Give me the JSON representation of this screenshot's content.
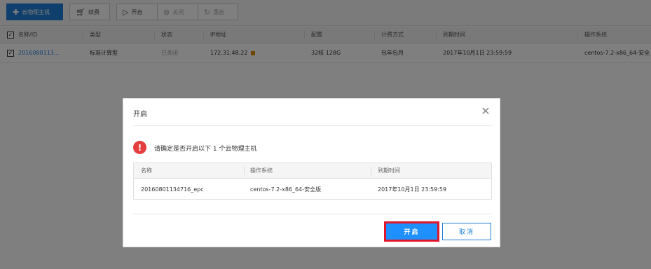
{
  "toolbar": {
    "create": {
      "label": "云物理主机",
      "icon": "plus-icon"
    },
    "renew": {
      "label": "续费",
      "icon": "cart-icon"
    },
    "start": {
      "label": "开启",
      "icon": "play-circle-icon"
    },
    "stop": {
      "label": "关闭",
      "icon": "stop-circle-icon"
    },
    "restart": {
      "label": "重启",
      "icon": "restart-icon"
    }
  },
  "table": {
    "headers": [
      "名称/ID",
      "类型",
      "状态",
      "IP地址",
      "配置",
      "计费方式",
      "到期时间",
      "操作系统"
    ],
    "row": {
      "name": "2016080113...",
      "type": "标准计算型",
      "status": "已关闭",
      "ip": "172.31.48.22",
      "config": "32核 128G",
      "billing": "包年包月",
      "expire": "2017年10月1日 23:59:59",
      "os": "centos-7.2-x86_64-安全"
    }
  },
  "modal": {
    "title": "开启",
    "message": "请确定是否开启以下 1 个云物理主机",
    "headers": [
      "名称",
      "操作系统",
      "到期时间"
    ],
    "row": {
      "name": "20160801134716_epc",
      "os": "centos-7.2-x86_64-安全版",
      "expire": "2017年10月1日 23:59:59"
    },
    "confirm_label": "开启",
    "cancel_label": "取消"
  },
  "colors": {
    "primary": "#1e7fd8",
    "confirm": "#1e90ff",
    "highlight": "#e0162b",
    "warning": "#e53e3e"
  }
}
